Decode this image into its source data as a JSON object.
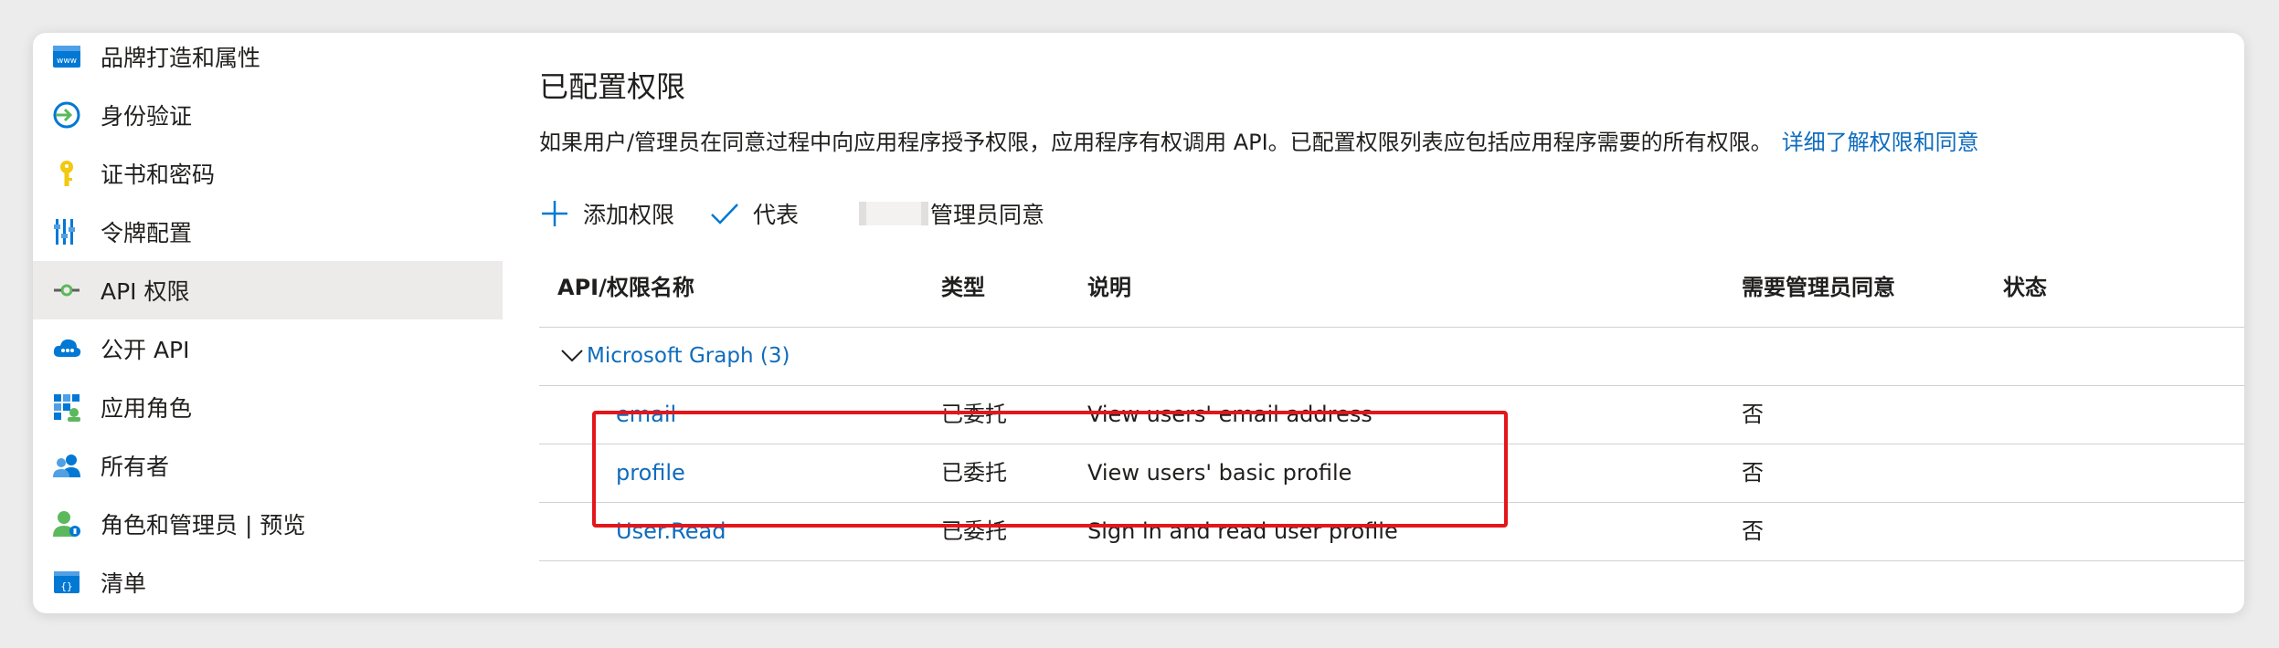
{
  "sidebar": {
    "items": [
      {
        "label": "品牌打造和属性",
        "icon": "www-branding-icon"
      },
      {
        "label": "身份验证",
        "icon": "authentication-icon"
      },
      {
        "label": "证书和密码",
        "icon": "key-icon"
      },
      {
        "label": "令牌配置",
        "icon": "token-configuration-icon"
      },
      {
        "label": "API 权限",
        "icon": "api-permissions-icon",
        "active": true
      },
      {
        "label": "公开 API",
        "icon": "expose-api-cloud-icon"
      },
      {
        "label": "应用角色",
        "icon": "app-roles-grid-icon"
      },
      {
        "label": "所有者",
        "icon": "owners-users-icon"
      },
      {
        "label": "角色和管理员 | 预览",
        "icon": "roles-admins-icon"
      },
      {
        "label": "清单",
        "icon": "manifest-icon"
      }
    ]
  },
  "main": {
    "title": "已配置权限",
    "description": "如果用户/管理员在同意过程中向应用程序授予权限，应用程序有权调用 API。已配置权限列表应包括应用程序需要的所有权限。",
    "learn_more": "详细了解权限和同意",
    "toolbar": {
      "add_permission": "添加权限",
      "grant_consent_prefix": "代表",
      "grant_consent_suffix": "管理员同意"
    },
    "table": {
      "headers": {
        "name": "API/权限名称",
        "type": "类型",
        "description": "说明",
        "admin_consent": "需要管理员同意",
        "status": "状态"
      },
      "group": "Microsoft Graph (3)",
      "rows": [
        {
          "name": "email",
          "type": "已委托",
          "description": "View users' email address",
          "admin_consent": "否"
        },
        {
          "name": "profile",
          "type": "已委托",
          "description": "View users' basic profile",
          "admin_consent": "否"
        },
        {
          "name": "User.Read",
          "type": "已委托",
          "description": "Sign in and read user profile",
          "admin_consent": "否"
        }
      ]
    }
  },
  "colors": {
    "link": "#0f6cbd",
    "active_bg": "#edebe9",
    "highlight": "#e3161b",
    "divider": "#d1d1d1"
  }
}
